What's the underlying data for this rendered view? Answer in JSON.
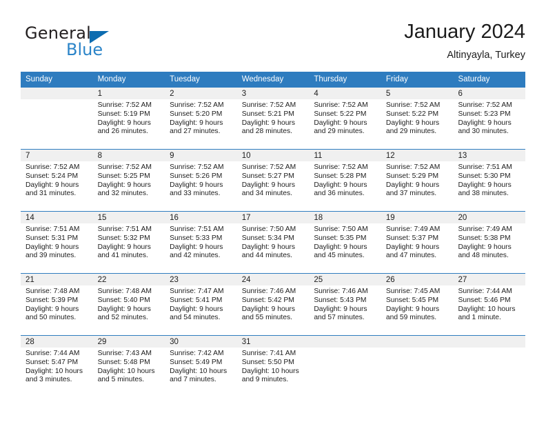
{
  "brand": {
    "name_part1": "General",
    "name_part2": "Blue",
    "triangle_icon": "triangle-icon",
    "accent_color": "#2b84c8",
    "triangle_color": "#0d6cb0"
  },
  "header": {
    "month_title": "January 2024",
    "location": "Altinyayla, Turkey"
  },
  "calendar": {
    "header_bg_color": "#2e7cbf",
    "date_band_color": "#f0f0f0",
    "weekdays": [
      "Sunday",
      "Monday",
      "Tuesday",
      "Wednesday",
      "Thursday",
      "Friday",
      "Saturday"
    ],
    "weeks": [
      [
        {
          "day": "",
          "sunrise": "",
          "sunset": "",
          "daylight": "",
          "empty": true
        },
        {
          "day": "1",
          "sunrise": "Sunrise: 7:52 AM",
          "sunset": "Sunset: 5:19 PM",
          "daylight": "Daylight: 9 hours and 26 minutes."
        },
        {
          "day": "2",
          "sunrise": "Sunrise: 7:52 AM",
          "sunset": "Sunset: 5:20 PM",
          "daylight": "Daylight: 9 hours and 27 minutes."
        },
        {
          "day": "3",
          "sunrise": "Sunrise: 7:52 AM",
          "sunset": "Sunset: 5:21 PM",
          "daylight": "Daylight: 9 hours and 28 minutes."
        },
        {
          "day": "4",
          "sunrise": "Sunrise: 7:52 AM",
          "sunset": "Sunset: 5:22 PM",
          "daylight": "Daylight: 9 hours and 29 minutes."
        },
        {
          "day": "5",
          "sunrise": "Sunrise: 7:52 AM",
          "sunset": "Sunset: 5:22 PM",
          "daylight": "Daylight: 9 hours and 29 minutes."
        },
        {
          "day": "6",
          "sunrise": "Sunrise: 7:52 AM",
          "sunset": "Sunset: 5:23 PM",
          "daylight": "Daylight: 9 hours and 30 minutes."
        }
      ],
      [
        {
          "day": "7",
          "sunrise": "Sunrise: 7:52 AM",
          "sunset": "Sunset: 5:24 PM",
          "daylight": "Daylight: 9 hours and 31 minutes."
        },
        {
          "day": "8",
          "sunrise": "Sunrise: 7:52 AM",
          "sunset": "Sunset: 5:25 PM",
          "daylight": "Daylight: 9 hours and 32 minutes."
        },
        {
          "day": "9",
          "sunrise": "Sunrise: 7:52 AM",
          "sunset": "Sunset: 5:26 PM",
          "daylight": "Daylight: 9 hours and 33 minutes."
        },
        {
          "day": "10",
          "sunrise": "Sunrise: 7:52 AM",
          "sunset": "Sunset: 5:27 PM",
          "daylight": "Daylight: 9 hours and 34 minutes."
        },
        {
          "day": "11",
          "sunrise": "Sunrise: 7:52 AM",
          "sunset": "Sunset: 5:28 PM",
          "daylight": "Daylight: 9 hours and 36 minutes."
        },
        {
          "day": "12",
          "sunrise": "Sunrise: 7:52 AM",
          "sunset": "Sunset: 5:29 PM",
          "daylight": "Daylight: 9 hours and 37 minutes."
        },
        {
          "day": "13",
          "sunrise": "Sunrise: 7:51 AM",
          "sunset": "Sunset: 5:30 PM",
          "daylight": "Daylight: 9 hours and 38 minutes."
        }
      ],
      [
        {
          "day": "14",
          "sunrise": "Sunrise: 7:51 AM",
          "sunset": "Sunset: 5:31 PM",
          "daylight": "Daylight: 9 hours and 39 minutes."
        },
        {
          "day": "15",
          "sunrise": "Sunrise: 7:51 AM",
          "sunset": "Sunset: 5:32 PM",
          "daylight": "Daylight: 9 hours and 41 minutes."
        },
        {
          "day": "16",
          "sunrise": "Sunrise: 7:51 AM",
          "sunset": "Sunset: 5:33 PM",
          "daylight": "Daylight: 9 hours and 42 minutes."
        },
        {
          "day": "17",
          "sunrise": "Sunrise: 7:50 AM",
          "sunset": "Sunset: 5:34 PM",
          "daylight": "Daylight: 9 hours and 44 minutes."
        },
        {
          "day": "18",
          "sunrise": "Sunrise: 7:50 AM",
          "sunset": "Sunset: 5:35 PM",
          "daylight": "Daylight: 9 hours and 45 minutes."
        },
        {
          "day": "19",
          "sunrise": "Sunrise: 7:49 AM",
          "sunset": "Sunset: 5:37 PM",
          "daylight": "Daylight: 9 hours and 47 minutes."
        },
        {
          "day": "20",
          "sunrise": "Sunrise: 7:49 AM",
          "sunset": "Sunset: 5:38 PM",
          "daylight": "Daylight: 9 hours and 48 minutes."
        }
      ],
      [
        {
          "day": "21",
          "sunrise": "Sunrise: 7:48 AM",
          "sunset": "Sunset: 5:39 PM",
          "daylight": "Daylight: 9 hours and 50 minutes."
        },
        {
          "day": "22",
          "sunrise": "Sunrise: 7:48 AM",
          "sunset": "Sunset: 5:40 PM",
          "daylight": "Daylight: 9 hours and 52 minutes."
        },
        {
          "day": "23",
          "sunrise": "Sunrise: 7:47 AM",
          "sunset": "Sunset: 5:41 PM",
          "daylight": "Daylight: 9 hours and 54 minutes."
        },
        {
          "day": "24",
          "sunrise": "Sunrise: 7:46 AM",
          "sunset": "Sunset: 5:42 PM",
          "daylight": "Daylight: 9 hours and 55 minutes."
        },
        {
          "day": "25",
          "sunrise": "Sunrise: 7:46 AM",
          "sunset": "Sunset: 5:43 PM",
          "daylight": "Daylight: 9 hours and 57 minutes."
        },
        {
          "day": "26",
          "sunrise": "Sunrise: 7:45 AM",
          "sunset": "Sunset: 5:45 PM",
          "daylight": "Daylight: 9 hours and 59 minutes."
        },
        {
          "day": "27",
          "sunrise": "Sunrise: 7:44 AM",
          "sunset": "Sunset: 5:46 PM",
          "daylight": "Daylight: 10 hours and 1 minute."
        }
      ],
      [
        {
          "day": "28",
          "sunrise": "Sunrise: 7:44 AM",
          "sunset": "Sunset: 5:47 PM",
          "daylight": "Daylight: 10 hours and 3 minutes."
        },
        {
          "day": "29",
          "sunrise": "Sunrise: 7:43 AM",
          "sunset": "Sunset: 5:48 PM",
          "daylight": "Daylight: 10 hours and 5 minutes."
        },
        {
          "day": "30",
          "sunrise": "Sunrise: 7:42 AM",
          "sunset": "Sunset: 5:49 PM",
          "daylight": "Daylight: 10 hours and 7 minutes."
        },
        {
          "day": "31",
          "sunrise": "Sunrise: 7:41 AM",
          "sunset": "Sunset: 5:50 PM",
          "daylight": "Daylight: 10 hours and 9 minutes."
        },
        {
          "day": "",
          "sunrise": "",
          "sunset": "",
          "daylight": "",
          "empty": true,
          "noband": true
        },
        {
          "day": "",
          "sunrise": "",
          "sunset": "",
          "daylight": "",
          "empty": true,
          "noband": true
        },
        {
          "day": "",
          "sunrise": "",
          "sunset": "",
          "daylight": "",
          "empty": true,
          "noband": true
        }
      ]
    ]
  }
}
